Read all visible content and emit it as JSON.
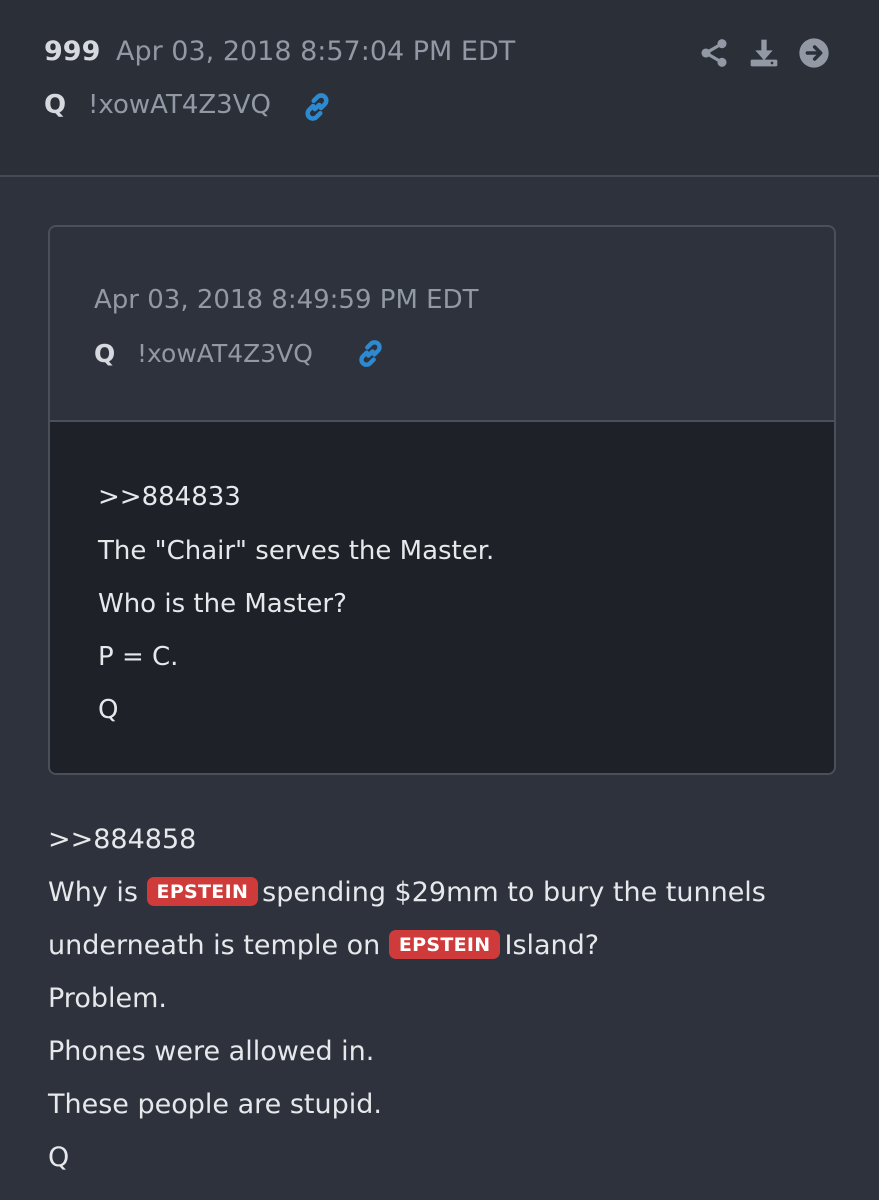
{
  "post": {
    "number": "999",
    "date": "Apr 03, 2018 8:57:04 PM EDT",
    "author": "Q",
    "tripcode": "!xowAT4Z3VQ",
    "actions": [
      "share-icon",
      "download-icon",
      "arrow-right-circle-icon"
    ]
  },
  "quoted": {
    "date": "Apr 03, 2018 8:49:59 PM EDT",
    "author": "Q",
    "tripcode": "!xowAT4Z3VQ",
    "lines": [
      ">>884833",
      "The \"Chair\" serves the Master.",
      "Who is the Master?",
      "P = C.",
      "Q"
    ]
  },
  "message": {
    "ref": ">>884858",
    "line1_before": "Why is",
    "line1_badge": "EPSTEIN",
    "line1_after": "spending $29mm to bury the tunnels",
    "line2_before": "underneath is temple on",
    "line2_badge": "EPSTEIN",
    "line2_after": "Island?",
    "lines": [
      "Problem.",
      "Phones were allowed in.",
      "These people are stupid.",
      "Q"
    ]
  },
  "colors": {
    "background": "#2d323c",
    "quote_body": "#1e2128",
    "badge": "#cf3a3a",
    "link": "#2d8ad0",
    "icon": "#9299a4"
  }
}
